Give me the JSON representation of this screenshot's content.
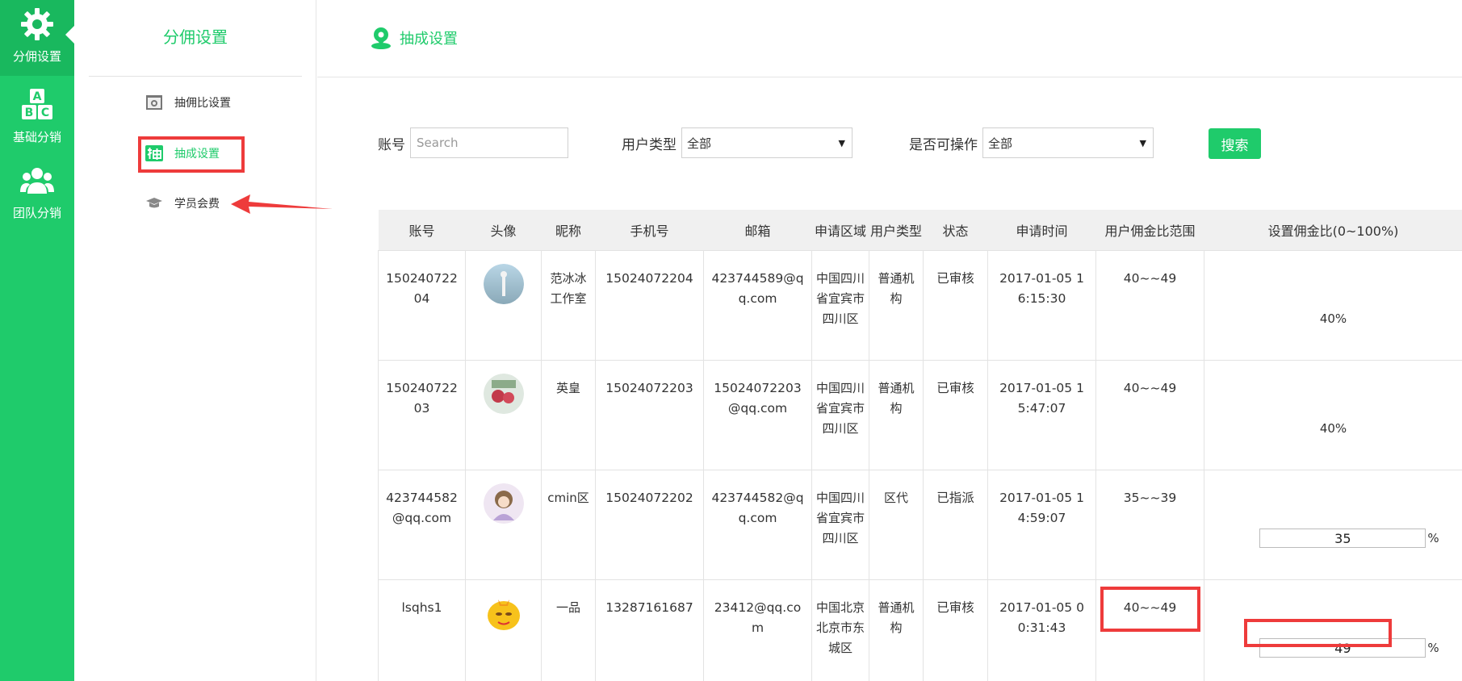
{
  "rail": {
    "items": [
      {
        "label": "分佣设置",
        "icon": "gear-icon"
      },
      {
        "label": "基础分销",
        "icon": "abc-blocks-icon"
      },
      {
        "label": "团队分销",
        "icon": "team-icon"
      }
    ]
  },
  "subside": {
    "title": "分佣设置",
    "items": [
      {
        "label": "抽佣比设置",
        "icon": "camera-icon"
      },
      {
        "label": "抽成设置",
        "icon": "draw-char-icon"
      },
      {
        "label": "学员会费",
        "icon": "graduation-cap-icon"
      }
    ]
  },
  "main": {
    "title": "抽成设置",
    "title_icon": "user-pin-icon"
  },
  "filters": {
    "account_label": "账号",
    "account_placeholder": "Search",
    "user_type_label": "用户类型",
    "user_type_value": "全部",
    "operable_label": "是否可操作",
    "operable_value": "全部",
    "search_button": "搜索"
  },
  "table": {
    "headers": [
      "账号",
      "头像",
      "昵称",
      "手机号",
      "邮箱",
      "申请区域",
      "用户类型",
      "状态",
      "申请时间",
      "用户佣金比范围",
      "设置佣金比(0~100%)"
    ],
    "rows": [
      {
        "account": "15024072204",
        "nickname": "范冰冰工作室",
        "phone": "15024072204",
        "email": "423744589@qq.com",
        "region": "中国四川省宜宾市四川区",
        "user_type": "普通机构",
        "status": "已审核",
        "time": "2017-01-05 16:15:30",
        "range": "40~~49",
        "rate": "40%",
        "editable": false
      },
      {
        "account": "15024072203",
        "nickname": "英皇",
        "phone": "15024072203",
        "email": "15024072203@qq.com",
        "region": "中国四川省宜宾市四川区",
        "user_type": "普通机构",
        "status": "已审核",
        "time": "2017-01-05 15:47:07",
        "range": "40~~49",
        "rate": "40%",
        "editable": false
      },
      {
        "account": "423744582@qq.com",
        "nickname": "cmin区",
        "phone": "15024072202",
        "email": "423744582@qq.com",
        "region": "中国四川省宜宾市四川区",
        "user_type": "区代",
        "status": "已指派",
        "time": "2017-01-05 14:59:07",
        "range": "35~~39",
        "rate": "35",
        "editable": true,
        "pct": "%"
      },
      {
        "account": "lsqhs1",
        "nickname": "一品",
        "phone": "13287161687",
        "email": "23412@qq.com",
        "region": "中国北京北京市东城区",
        "user_type": "普通机构",
        "status": "已审核",
        "time": "2017-01-05 00:31:43",
        "range": "40~~49",
        "rate": "49",
        "editable": true,
        "pct": "%"
      }
    ]
  },
  "colors": {
    "brand_green": "#1fcb6b",
    "highlight_red": "#ee3b3b"
  }
}
